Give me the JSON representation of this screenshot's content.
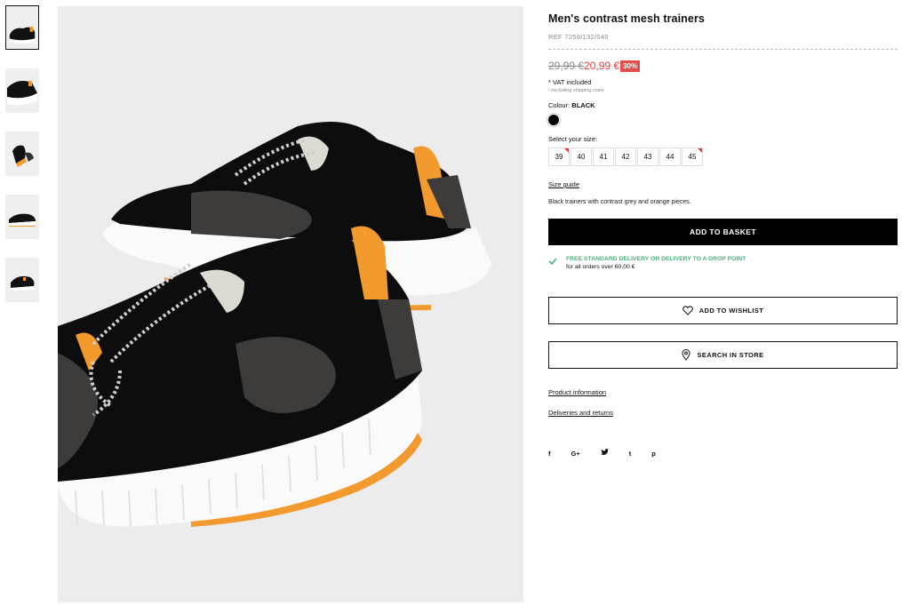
{
  "product": {
    "title": "Men's contrast mesh trainers",
    "ref": "REF 7258/132/040",
    "old_price": "29,99 €",
    "new_price": "20,99 €",
    "discount": "30%",
    "vat": "* VAT included",
    "shipping": "/ excluding shipping costs",
    "colour_label": "Colour:",
    "colour_value": "BLACK",
    "size_label": "Select your size:",
    "sizes": [
      "39",
      "40",
      "41",
      "42",
      "43",
      "44",
      "45"
    ],
    "size_guide": "Size guide",
    "description": "Black trainers with contrast grey and orange pieces."
  },
  "actions": {
    "add_to_basket": "ADD TO BASKET",
    "add_to_wishlist": "ADD TO WISHLIST",
    "search_in_store": "SEARCH IN STORE"
  },
  "delivery": {
    "line1": "FREE STANDARD DELIVERY OR DELIVERY TO A DROP POINT",
    "line2": "for all orders over 60,00 €"
  },
  "links": {
    "product_info": "Product information",
    "deliveries": "Deliveries and returns"
  },
  "social": [
    "f",
    "G+",
    "t-bird",
    "t",
    "p"
  ],
  "social_glyphs": {
    "facebook": "f",
    "google": "G+",
    "twitter": "🐦",
    "tumblr": "t",
    "pinterest": "p"
  },
  "colors": {
    "accent_red": "#e83c3c",
    "delivery_green": "#4caf7d",
    "shoe_orange": "#f39a2e"
  }
}
